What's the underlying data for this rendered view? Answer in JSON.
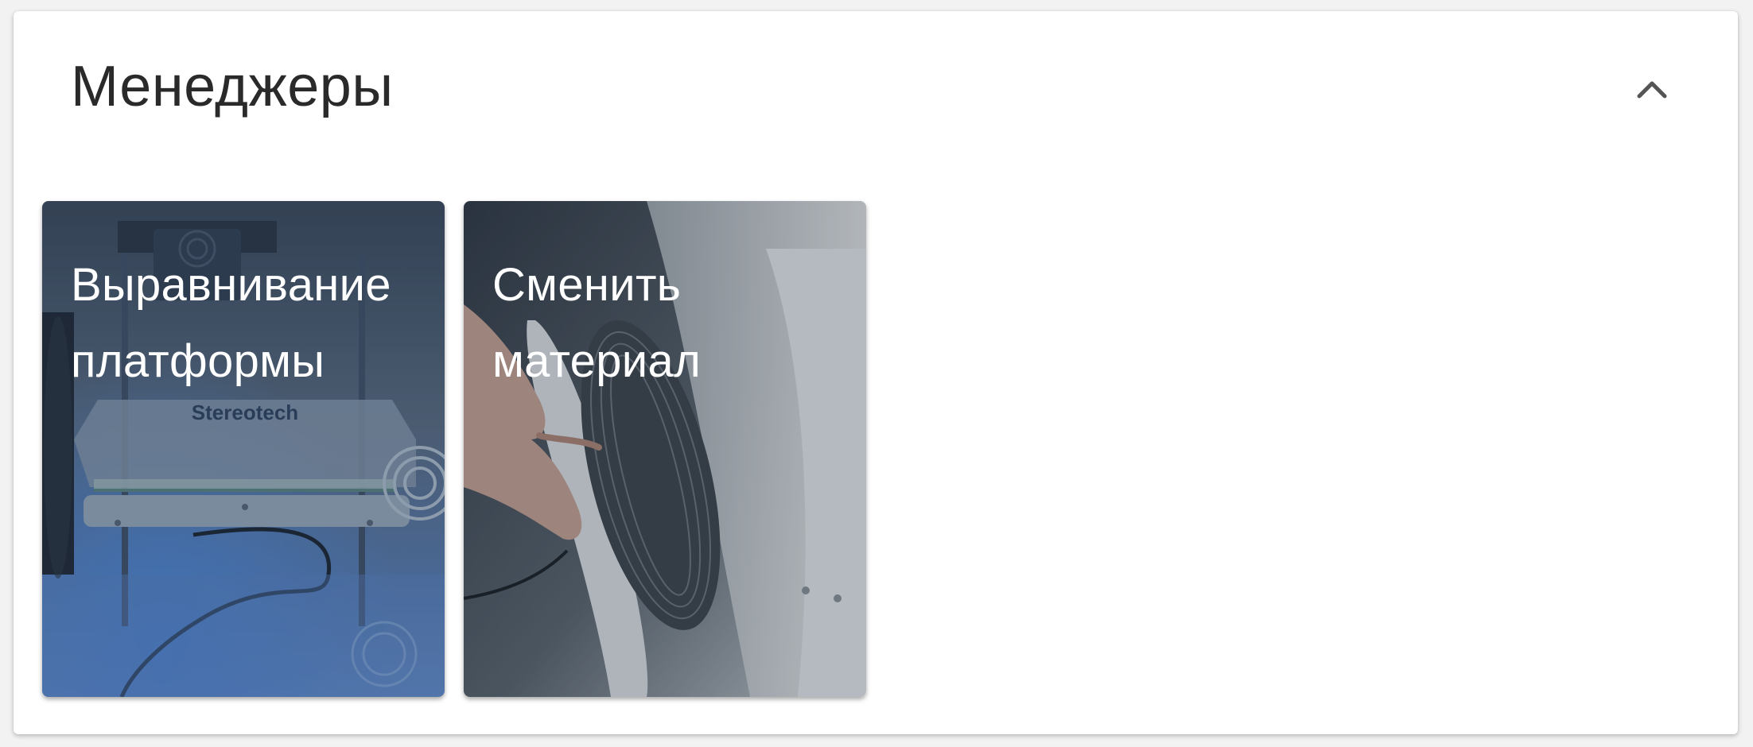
{
  "section": {
    "title": "Менеджеры",
    "collapse_icon": "chevron-up-icon"
  },
  "tiles": [
    {
      "label": "Выравнивание платформы",
      "image": "3D printer build platform with Stereotech logo",
      "logo_text": "Stereotech"
    },
    {
      "label": "Сменить материал",
      "image": "hand loading filament spool"
    }
  ],
  "colors": {
    "overlay": "#2b3a4a",
    "accent_blue": "#3f7fd6"
  }
}
